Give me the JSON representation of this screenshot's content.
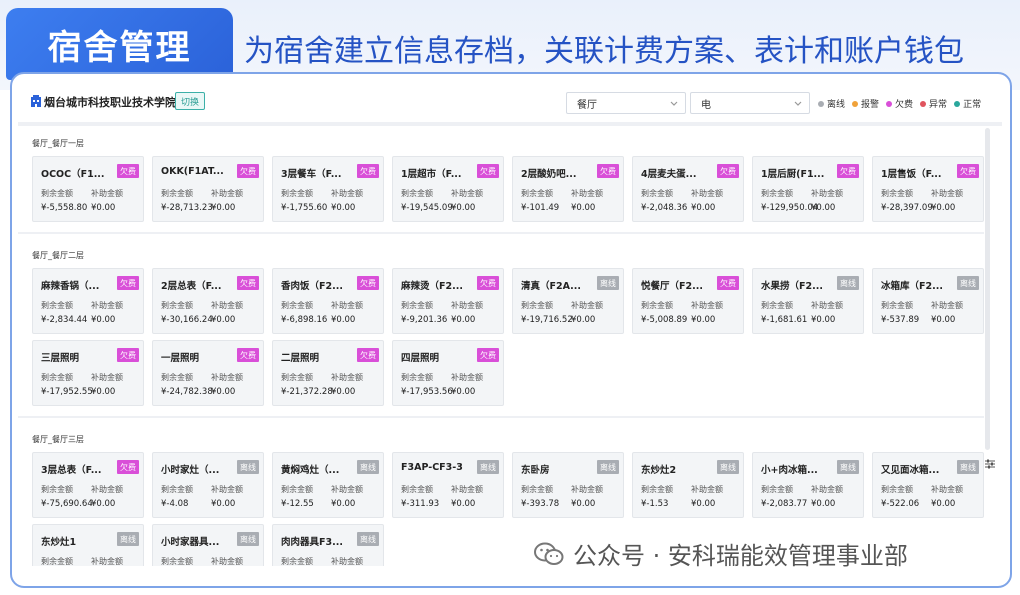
{
  "banner": {
    "title": "宿舍管理",
    "description": "为宿舍建立信息存档，关联计费方案、表计和账户钱包"
  },
  "header": {
    "school": "烟台城市科技职业技术学院",
    "switch_label": "切换",
    "select_area": "餐厅",
    "select_type": "电"
  },
  "legend": [
    {
      "label": "离线",
      "color": "#a9adb3"
    },
    {
      "label": "报警",
      "color": "#f0a23a"
    },
    {
      "label": "欠费",
      "color": "#d94fd8"
    },
    {
      "label": "异常",
      "color": "#e0545e"
    },
    {
      "label": "正常",
      "color": "#2aa79c"
    }
  ],
  "labels": {
    "remaining": "剩余金额",
    "subsidy": "补助金额"
  },
  "groups": [
    {
      "title": "餐厅_餐厅一层",
      "cards": [
        {
          "name": "OCOC（F1...",
          "status": "欠费",
          "remaining": "¥-5,558.80",
          "subsidy": "¥0.00"
        },
        {
          "name": "OKK(F1AT...",
          "status": "欠费",
          "remaining": "¥-28,713.23",
          "subsidy": "¥0.00"
        },
        {
          "name": "3层餐车（F...",
          "status": "欠费",
          "remaining": "¥-1,755.60",
          "subsidy": "¥0.00"
        },
        {
          "name": "1层超市（F...",
          "status": "欠费",
          "remaining": "¥-19,545.09",
          "subsidy": "¥0.00"
        },
        {
          "name": "2层酸奶吧...",
          "status": "欠费",
          "remaining": "¥-101.49",
          "subsidy": "¥0.00"
        },
        {
          "name": "4层麦夫蛋...",
          "status": "欠费",
          "remaining": "¥-2,048.36",
          "subsidy": "¥0.00"
        },
        {
          "name": "1层后厨(F1...",
          "status": "欠费",
          "remaining": "¥-129,950.04",
          "subsidy": "¥0.00"
        },
        {
          "name": "1层售饭（F...",
          "status": "欠费",
          "remaining": "¥-28,397.09",
          "subsidy": "¥0.00"
        }
      ]
    },
    {
      "title": "餐厅_餐厅二层",
      "cards": [
        {
          "name": "麻辣香锅（...",
          "status": "欠费",
          "remaining": "¥-2,834.44",
          "subsidy": "¥0.00"
        },
        {
          "name": "2层总表（F...",
          "status": "欠费",
          "remaining": "¥-30,166.24",
          "subsidy": "¥0.00"
        },
        {
          "name": "香肉饭（F2...",
          "status": "欠费",
          "remaining": "¥-6,898.16",
          "subsidy": "¥0.00"
        },
        {
          "name": "麻辣烫（F2...",
          "status": "欠费",
          "remaining": "¥-9,201.36",
          "subsidy": "¥0.00"
        },
        {
          "name": "清真（F2A...",
          "status": "离线",
          "remaining": "¥-19,716.52",
          "subsidy": "¥0.00"
        },
        {
          "name": "悦餐厅（F2...",
          "status": "欠费",
          "remaining": "¥-5,008.89",
          "subsidy": "¥0.00"
        },
        {
          "name": "水果捞（F2...",
          "status": "离线",
          "remaining": "¥-1,681.61",
          "subsidy": "¥0.00"
        },
        {
          "name": "冰箱库（F2...",
          "status": "离线",
          "remaining": "¥-537.89",
          "subsidy": "¥0.00"
        },
        {
          "name": "三层照明",
          "status": "欠费",
          "remaining": "¥-17,952.55",
          "subsidy": "¥0.00"
        },
        {
          "name": "一层照明",
          "status": "欠费",
          "remaining": "¥-24,782.38",
          "subsidy": "¥0.00"
        },
        {
          "name": "二层照明",
          "status": "欠费",
          "remaining": "¥-21,372.28",
          "subsidy": "¥0.00"
        },
        {
          "name": "四层照明",
          "status": "欠费",
          "remaining": "¥-17,953.56",
          "subsidy": "¥0.00"
        }
      ]
    },
    {
      "title": "餐厅_餐厅三层",
      "cards": [
        {
          "name": "3层总表（F...",
          "status": "欠费",
          "remaining": "¥-75,690.64",
          "subsidy": "¥0.00"
        },
        {
          "name": "小时家灶（...",
          "status": "离线",
          "remaining": "¥-4.08",
          "subsidy": "¥0.00"
        },
        {
          "name": "黄焖鸡灶（...",
          "status": "离线",
          "remaining": "¥-12.55",
          "subsidy": "¥0.00"
        },
        {
          "name": "F3AP-CF3-3",
          "status": "离线",
          "remaining": "¥-311.93",
          "subsidy": "¥0.00"
        },
        {
          "name": "东卧房",
          "status": "离线",
          "remaining": "¥-393.78",
          "subsidy": "¥0.00"
        },
        {
          "name": "东炒灶2",
          "status": "离线",
          "remaining": "¥-1.53",
          "subsidy": "¥0.00"
        },
        {
          "name": "小+肉冰箱...",
          "status": "离线",
          "remaining": "¥-2,083.77",
          "subsidy": "¥0.00"
        },
        {
          "name": "又见面冰箱...",
          "status": "离线",
          "remaining": "¥-522.06",
          "subsidy": "¥0.00"
        },
        {
          "name": "东炒灶1",
          "status": "离线",
          "remaining": "",
          "subsidy": ""
        },
        {
          "name": "小时家器具...",
          "status": "离线",
          "remaining": "",
          "subsidy": ""
        },
        {
          "name": "肉肉器具F3...",
          "status": "离线",
          "remaining": "",
          "subsidy": ""
        }
      ]
    }
  ],
  "watermark": "公众号 · 安科瑞能效管理事业部"
}
